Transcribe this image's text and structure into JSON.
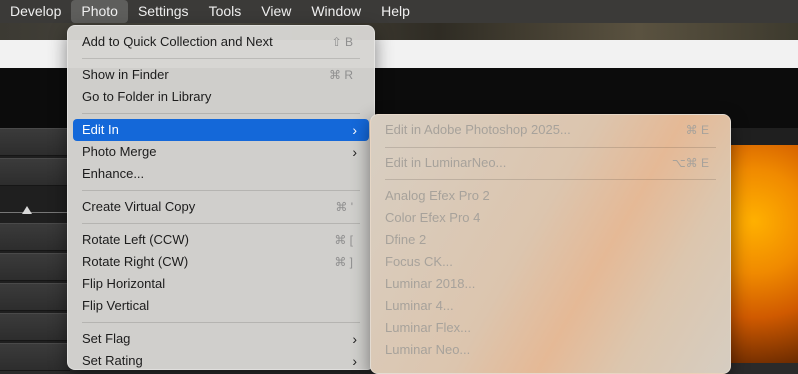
{
  "menubar": {
    "items": [
      "Develop",
      "Photo",
      "Settings",
      "Tools",
      "View",
      "Window",
      "Help"
    ],
    "active": "Photo"
  },
  "photo_menu": {
    "items": [
      {
        "label": "Add to Quick Collection and Next",
        "shortcut": "⇧ B"
      },
      {
        "label": "Show in Finder",
        "shortcut": "⌘ R"
      },
      {
        "label": "Go to Folder in Library",
        "shortcut": ""
      },
      {
        "label": "Edit In",
        "shortcut": "",
        "submenu": true,
        "highlighted": true
      },
      {
        "label": "Photo Merge",
        "shortcut": "",
        "submenu": true
      },
      {
        "label": "Enhance...",
        "shortcut": ""
      },
      {
        "label": "Create Virtual Copy",
        "shortcut": "⌘ '"
      },
      {
        "label": "Rotate Left (CCW)",
        "shortcut": "⌘ ["
      },
      {
        "label": "Rotate Right (CW)",
        "shortcut": "⌘ ]"
      },
      {
        "label": "Flip Horizontal",
        "shortcut": ""
      },
      {
        "label": "Flip Vertical",
        "shortcut": ""
      },
      {
        "label": "Set Flag",
        "shortcut": "",
        "submenu": true
      },
      {
        "label": "Set Rating",
        "shortcut": "",
        "submenu": true
      }
    ]
  },
  "edit_in_submenu": {
    "items": [
      {
        "label": "Edit in Adobe Photoshop 2025...",
        "shortcut": "⌘ E"
      },
      {
        "label": "Edit in LuminarNeo...",
        "shortcut": "⌥⌘ E"
      },
      {
        "label": "Analog Efex Pro 2",
        "shortcut": ""
      },
      {
        "label": "Color Efex Pro 4",
        "shortcut": ""
      },
      {
        "label": "Dfine 2",
        "shortcut": ""
      },
      {
        "label": "Focus CK...",
        "shortcut": ""
      },
      {
        "label": "Luminar 2018...",
        "shortcut": ""
      },
      {
        "label": "Luminar 4...",
        "shortcut": ""
      },
      {
        "label": "Luminar Flex...",
        "shortcut": ""
      },
      {
        "label": "Luminar Neo...",
        "shortcut": ""
      }
    ]
  },
  "icons": {
    "submenu_chevron": "chevron-right-icon",
    "slider_thumb": "slider-thumb-icon"
  },
  "colors": {
    "highlight": "#1468d9",
    "menubar": "#3b3a38"
  }
}
